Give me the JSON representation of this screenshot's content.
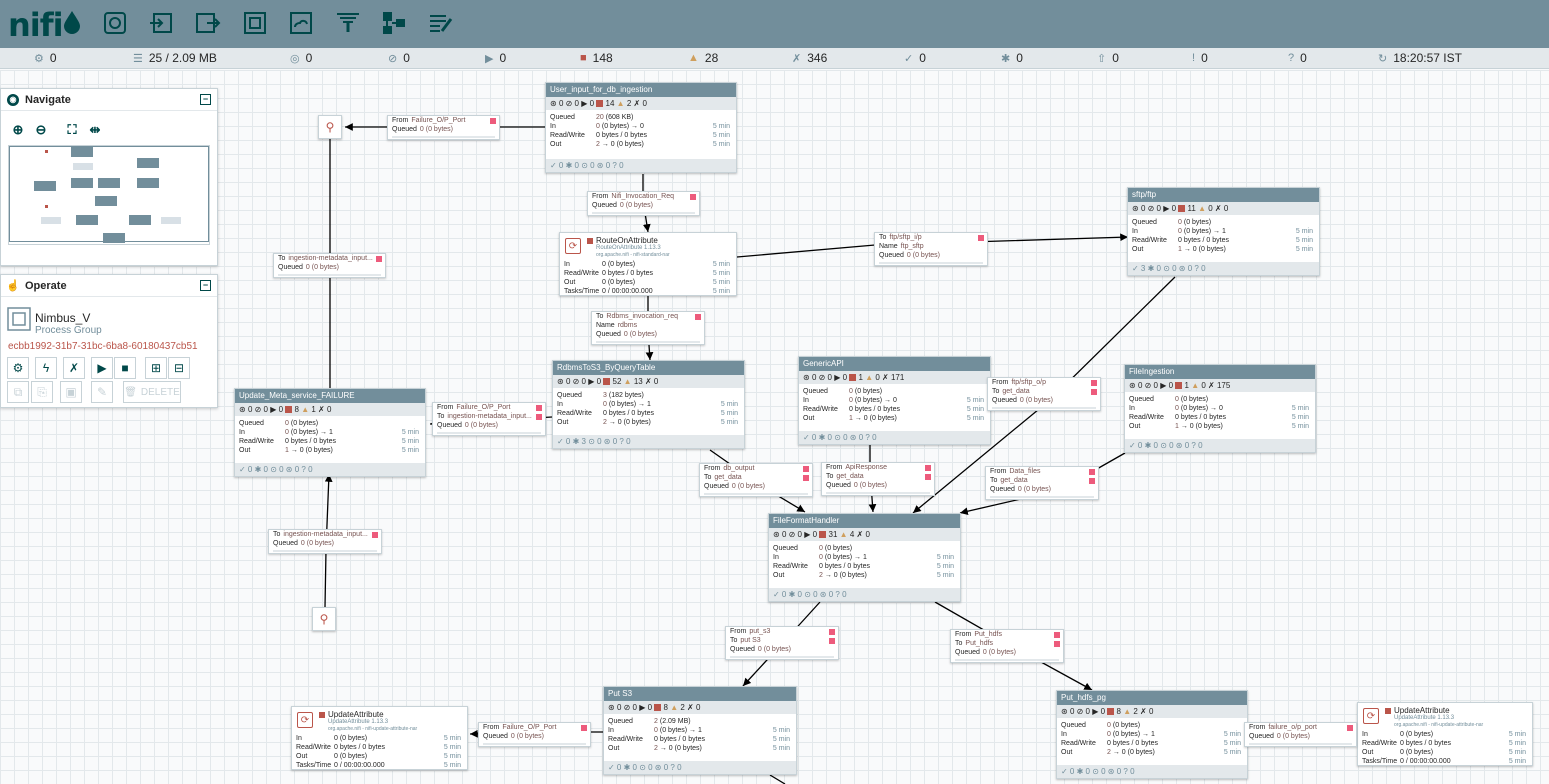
{
  "logo": {
    "text": "nifi"
  },
  "toolbar": {
    "items": [
      {
        "name": "processor-icon"
      },
      {
        "name": "input-port-icon"
      },
      {
        "name": "output-port-icon"
      },
      {
        "name": "process-group-icon"
      },
      {
        "name": "remote-process-group-icon"
      },
      {
        "name": "funnel-icon"
      },
      {
        "name": "template-icon"
      },
      {
        "name": "label-icon"
      }
    ]
  },
  "status": {
    "cluster": "0",
    "queued": "25 / 2.09 MB",
    "transmitting": "0",
    "not_transmitting": "0",
    "running": "0",
    "stopped": "148",
    "invalid": "28",
    "disabled": "346",
    "up_to_date": "0",
    "locally_modified": "0",
    "stale": "0",
    "locally_modified_stale": "0",
    "sync_failure": "0",
    "refreshed": "18:20:57 IST"
  },
  "navigate": {
    "title": "Navigate"
  },
  "operate": {
    "title": "Operate",
    "name": "Nimbus_V",
    "type": "Process Group",
    "id": "ecbb1992-31b7-31bc-6ba8-60180437cb51",
    "delete_label": "DELETE"
  },
  "groups": {
    "user_input": {
      "title": "User_input_for_db_ingestion",
      "bar": {
        "transmitting": "0",
        "not_transmitting": "0",
        "running": "0",
        "stopped": "14",
        "invalid": "2",
        "disabled": "0"
      },
      "queued": "20",
      "queued_size": "(608 KB)",
      "in": "0",
      "in_size": "(0 bytes) → 0",
      "rw": "0 bytes / 0 bytes",
      "out": "2",
      "out_size": "→ 0 (0 bytes)",
      "time": "5 min",
      "foot": "✓ 0  ✱ 0  ⊙ 0  ⊛ 0  ? 0"
    },
    "sftp": {
      "title": "sftp/ftp",
      "bar": {
        "transmitting": "0",
        "not_transmitting": "0",
        "running": "0",
        "stopped": "11",
        "invalid": "0",
        "disabled": "0"
      },
      "queued": "0",
      "queued_size": "(0 bytes)",
      "in": "0",
      "in_size": "(0 bytes) → 1",
      "rw": "0 bytes / 0 bytes",
      "out": "1",
      "out_size": "→ 0 (0 bytes)",
      "time": "5 min",
      "foot": "✓ 3  ✱ 0  ⊙ 0  ⊛ 0  ? 0"
    },
    "rdbms": {
      "title": "RdbmsToS3_ByQueryTable",
      "bar": {
        "transmitting": "0",
        "not_transmitting": "0",
        "running": "0",
        "stopped": "52",
        "invalid": "13",
        "disabled": "0"
      },
      "queued": "3",
      "queued_size": "(182 bytes)",
      "in": "0",
      "in_size": "(0 bytes) → 1",
      "rw": "0 bytes / 0 bytes",
      "out": "2",
      "out_size": "→ 0 (0 bytes)",
      "time": "5 min",
      "foot": "✓ 0  ✱ 3  ⊙ 0  ⊛ 0  ? 0"
    },
    "generic_api": {
      "title": "GenericAPI",
      "bar": {
        "transmitting": "0",
        "not_transmitting": "0",
        "running": "0",
        "stopped": "1",
        "invalid": "0",
        "disabled": "171"
      },
      "queued": "0",
      "queued_size": "(0 bytes)",
      "in": "0",
      "in_size": "(0 bytes) → 0",
      "rw": "0 bytes / 0 bytes",
      "out": "1",
      "out_size": "→ 0 (0 bytes)",
      "time": "5 min",
      "foot": "✓ 0  ✱ 0  ⊙ 0  ⊛ 0  ? 0"
    },
    "file_ingestion": {
      "title": "FileIngestion",
      "bar": {
        "transmitting": "0",
        "not_transmitting": "0",
        "running": "0",
        "stopped": "1",
        "invalid": "0",
        "disabled": "175"
      },
      "queued": "0",
      "queued_size": "(0 bytes)",
      "in": "0",
      "in_size": "(0 bytes) → 0",
      "rw": "0 bytes / 0 bytes",
      "out": "1",
      "out_size": "→ 0 (0 bytes)",
      "time": "5 min",
      "foot": "✓ 0  ✱ 0  ⊙ 0  ⊛ 0  ? 0"
    },
    "update_meta": {
      "title": "Update_Meta_service_FAILURE",
      "bar": {
        "transmitting": "0",
        "not_transmitting": "0",
        "running": "0",
        "stopped": "8",
        "invalid": "1",
        "disabled": "0"
      },
      "queued": "0",
      "queued_size": "(0 bytes)",
      "in": "0",
      "in_size": "(0 bytes) → 1",
      "rw": "0 bytes / 0 bytes",
      "out": "1",
      "out_size": "→ 0 (0 bytes)",
      "time": "5 min",
      "foot": "✓ 0  ✱ 0  ⊙ 0  ⊛ 0  ? 0"
    },
    "file_format": {
      "title": "FileFormatHandler",
      "bar": {
        "transmitting": "0",
        "not_transmitting": "0",
        "running": "0",
        "stopped": "31",
        "invalid": "4",
        "disabled": "0"
      },
      "queued": "0",
      "queued_size": "(0 bytes)",
      "in": "0",
      "in_size": "(0 bytes) → 1",
      "rw": "0 bytes / 0 bytes",
      "out": "2",
      "out_size": "→ 0 (0 bytes)",
      "time": "5 min",
      "foot": "✓ 0  ✱ 0  ⊙ 0  ⊛ 0  ? 0"
    },
    "put_s3": {
      "title": "Put S3",
      "bar": {
        "transmitting": "0",
        "not_transmitting": "0",
        "running": "0",
        "stopped": "8",
        "invalid": "2",
        "disabled": "0"
      },
      "queued": "2",
      "queued_size": "(2.09 MB)",
      "in": "0",
      "in_size": "(0 bytes) → 1",
      "rw": "0 bytes / 0 bytes",
      "out": "2",
      "out_size": "→ 0 (0 bytes)",
      "time": "5 min",
      "foot": "✓ 0  ✱ 0  ⊙ 0  ⊛ 0  ? 0"
    },
    "put_hdfs": {
      "title": "Put_hdfs_pg",
      "bar": {
        "transmitting": "0",
        "not_transmitting": "0",
        "running": "0",
        "stopped": "8",
        "invalid": "2",
        "disabled": "0"
      },
      "queued": "0",
      "queued_size": "(0 bytes)",
      "in": "0",
      "in_size": "(0 bytes) → 1",
      "rw": "0 bytes / 0 bytes",
      "out": "2",
      "out_size": "→ 0 (0 bytes)",
      "time": "5 min",
      "foot": "✓ 0  ✱ 0  ⊙ 0  ⊛ 0  ? 0"
    }
  },
  "processors": {
    "route": {
      "name": "RouteOnAttribute",
      "type": "RouteOnAttribute 1.13.3",
      "bundle": "org.apache.nifi - nifi-standard-nar",
      "in": "0 (0 bytes)",
      "rw": "0 bytes / 0 bytes",
      "out": "0 (0 bytes)",
      "tasks": "0 / 00:00:00.000",
      "time": "5 min"
    },
    "update_left": {
      "name": "UpdateAttribute",
      "type": "UpdateAttribute 1.13.3",
      "bundle": "org.apache.nifi - nifi-update-attribute-nar",
      "in": "0 (0 bytes)",
      "rw": "0 bytes / 0 bytes",
      "out": "0 (0 bytes)",
      "tasks": "0 / 00:00:00.000",
      "time": "5 min"
    },
    "update_right": {
      "name": "UpdateAttribute",
      "type": "UpdateAttribute 1.13.3",
      "bundle": "org.apache.nifi - nifi-update-attribute-nar",
      "in": "0 (0 bytes)",
      "rw": "0 bytes / 0 bytes",
      "out": "0 (0 bytes)",
      "tasks": "0 / 00:00:00.000",
      "time": "5 min"
    }
  },
  "row_labels": {
    "queued": "Queued",
    "in": "In",
    "rw": "Read/Write",
    "out": "Out",
    "tasks": "Tasks/Time"
  },
  "connections": {
    "failure_op": {
      "l1": "From",
      "v1": "Failure_O/P_Port",
      "l2": "Queued",
      "v2": "0 (0 bytes)"
    },
    "nifi_inv": {
      "l1": "From",
      "v1": "Nifi_Invocation_Req",
      "l2": "Queued",
      "v2": "0 (0 bytes)"
    },
    "to_ftp": {
      "l1": "To",
      "v1": "ftp/sftp_i/p",
      "l2": "Name",
      "v2": "ftp_sftp",
      "l3": "Queued",
      "v3": "0 (0 bytes)"
    },
    "ingest_top": {
      "l1": "To",
      "v1": "ingestion-metadata_input...",
      "l2": "Queued",
      "v2": "0 (0 bytes)"
    },
    "rdbms_inv": {
      "l1": "To",
      "v1": "Rdbms_invocation_req",
      "l2": "Name",
      "v2": "rdbms",
      "l3": "Queued",
      "v3": "0 (0 bytes)"
    },
    "failure_op2": {
      "l1": "From",
      "v1": "Failure_O/P_Port",
      "l2": "To",
      "v2": "ingestion-metadata_input...",
      "l3": "Queued",
      "v3": "0 (0 bytes)"
    },
    "ftp_op": {
      "l1": "From",
      "v1": "ftp/sftp_o/p",
      "l2": "To",
      "v2": "get_data",
      "l3": "Queued",
      "v3": "0 (0 bytes)"
    },
    "db_output": {
      "l1": "From",
      "v1": "db_output",
      "l2": "To",
      "v2": "get_data",
      "l3": "Queued",
      "v3": "0 (0 bytes)"
    },
    "api_resp": {
      "l1": "From",
      "v1": "ApiResponse",
      "l2": "To",
      "v2": "get_data",
      "l3": "Queued",
      "v3": "0 (0 bytes)"
    },
    "data_files": {
      "l1": "From",
      "v1": "Data_files",
      "l2": "To",
      "v2": "get_data",
      "l3": "Queued",
      "v3": "0 (0 bytes)"
    },
    "ingest_bottom": {
      "l1": "To",
      "v1": "ingestion-metadata_input...",
      "l2": "Queued",
      "v2": "0 (0 bytes)"
    },
    "put_s3": {
      "l1": "From",
      "v1": "put_s3",
      "l2": "To",
      "v2": "put S3",
      "l3": "Queued",
      "v3": "0 (0 bytes)"
    },
    "put_hdfs": {
      "l1": "From",
      "v1": "Put_hdfs",
      "l2": "To",
      "v2": "Put_hdfs",
      "l3": "Queued",
      "v3": "0 (0 bytes)"
    },
    "failure_op3": {
      "l1": "From",
      "v1": "Failure_O/P_Port",
      "l2": "Queued",
      "v2": "0 (0 bytes)"
    },
    "failure_op4": {
      "l1": "From",
      "v1": "failure_o/p_port",
      "l2": "Queued",
      "v2": "0 (0 bytes)"
    }
  },
  "colors": {
    "header": "#728e9b",
    "brand": "#004849",
    "stopped": "#ba554a",
    "invalid": "#cf9f5d"
  }
}
